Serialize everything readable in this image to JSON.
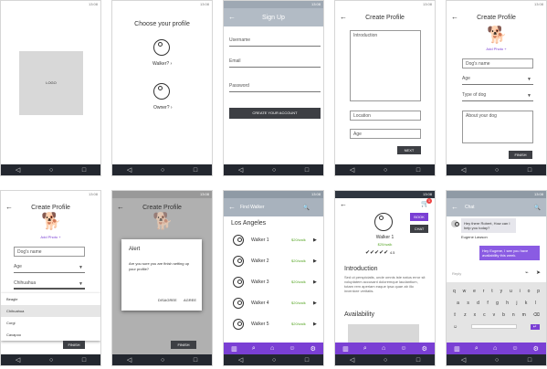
{
  "status": {
    "time": "13:08"
  },
  "nav": {
    "back": "◁",
    "home": "○",
    "recent": "□"
  },
  "screen1": {
    "logo": "LOGO"
  },
  "screen2": {
    "title": "Choose your profile",
    "walker": "Walker?",
    "owner": "Owner?",
    "arrow": "›"
  },
  "screen3": {
    "title": "Sign Up",
    "username": "Username",
    "email": "Email",
    "password": "Password",
    "button": "CREATE YOUR ACCOUNT"
  },
  "screen4": {
    "title": "Create Profile",
    "introduction": "Introduction",
    "location": "Location",
    "age": "Age",
    "next": "NEXT"
  },
  "screen5": {
    "title": "Create Profile",
    "add_photo": "Add Photo +",
    "dogs_name": "Dog's name",
    "age": "Age",
    "type": "Type of dog",
    "about": "About your dog",
    "finish": "FINISH"
  },
  "screen6": {
    "title": "Create Profile",
    "add_photo": "Add Photo +",
    "dogs_name": "Dog's name",
    "age": "Age",
    "breed": "Chihuahua",
    "options": [
      "Beagle",
      "Chihuahua",
      "Corgi",
      "Cavapoo"
    ],
    "finish": "FINISH"
  },
  "screen7": {
    "title": "Create Profile",
    "alert_title": "Alert",
    "alert_text": "Are you sure you are finish setting up your profile?",
    "disagree": "DISAGREE",
    "agree": "AGREE",
    "finish": "FINISH",
    "add_photo": "Add Photo +"
  },
  "screen8": {
    "title": "Find Walker",
    "city": "Los Angeles",
    "walkers": [
      {
        "name": "Walker 1",
        "price": "$20/walk"
      },
      {
        "name": "Walker 2",
        "price": "$20/walk"
      },
      {
        "name": "Walker 3",
        "price": "$20/walk"
      },
      {
        "name": "Walker 4",
        "price": "$20/walk"
      },
      {
        "name": "Walker 5",
        "price": "$20/walk"
      }
    ]
  },
  "screen9": {
    "walker": "Walker 1",
    "price": "$20/walk",
    "book": "BOOK",
    "chat": "CHAT",
    "rating": "4.5",
    "intro_title": "Introduction",
    "intro_text": "Sed ut perspiciatis, unde omnis iste natus error sit voluptatem accusant doloremque laudantium, totam rem aperiam eaque ipsa quae ab illo inventore veritatis.",
    "availability": "Availability",
    "cart_count": "1"
  },
  "screen10": {
    "title": "Chat",
    "msg1": "Hey there Robert, How can I help you today?",
    "sender": "Eugene Lawson",
    "msg2": "Hey Eugene, I see you have availability this week.",
    "placeholder": "Reply",
    "keys_row1": [
      "q",
      "w",
      "e",
      "r",
      "t",
      "y",
      "u",
      "i",
      "o",
      "p"
    ],
    "keys_row2": [
      "a",
      "s",
      "d",
      "f",
      "g",
      "h",
      "j",
      "k",
      "l"
    ],
    "keys_row3": [
      "z",
      "x",
      "c",
      "v",
      "b",
      "n",
      "m"
    ]
  }
}
